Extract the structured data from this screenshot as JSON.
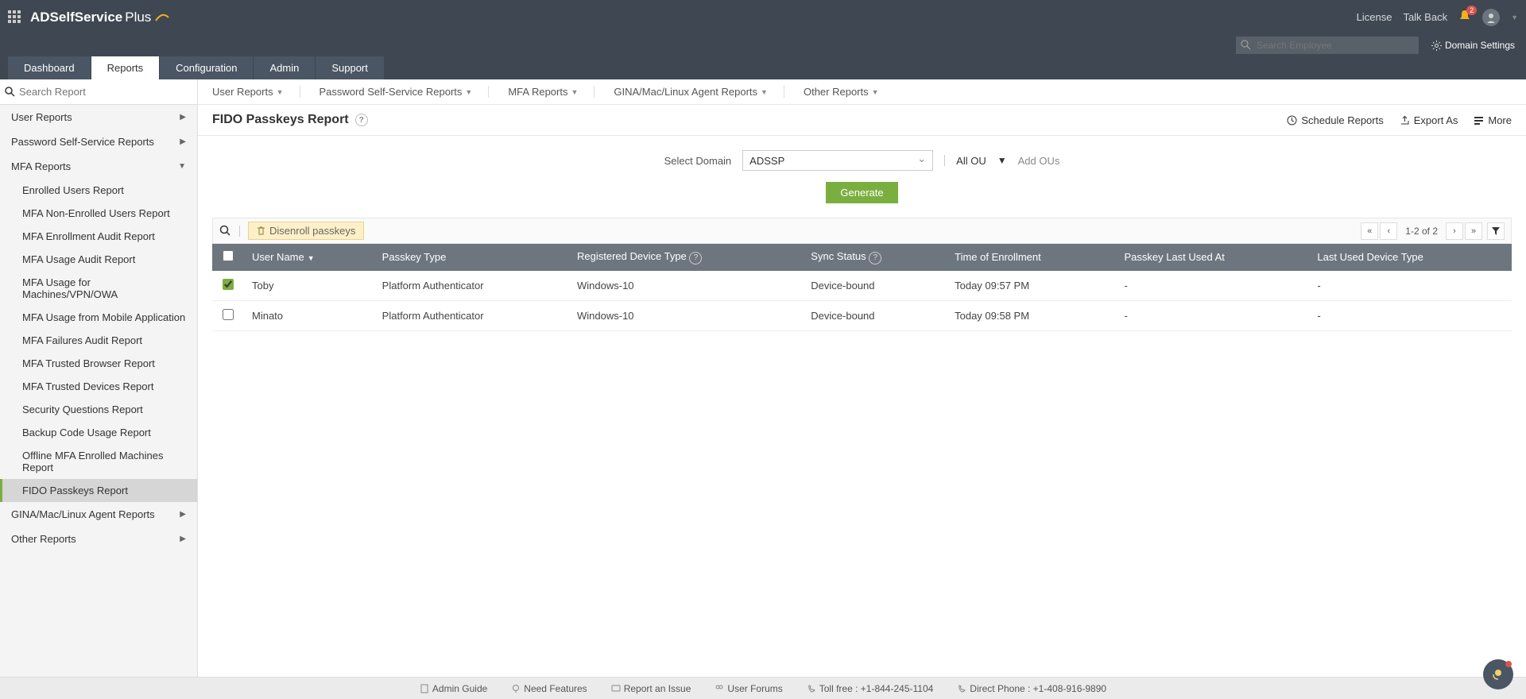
{
  "app_name": "ADSelfService",
  "app_suffix": "Plus",
  "top_links": {
    "license": "License",
    "talk_back": "Talk Back"
  },
  "notif_count": "2",
  "search_employee_ph": "Search Employee",
  "domain_settings": "Domain Settings",
  "tabs": [
    "Dashboard",
    "Reports",
    "Configuration",
    "Admin",
    "Support"
  ],
  "search_report_ph": "Search Report",
  "sidebar": {
    "user_reports": "User Reports",
    "pss_reports": "Password Self-Service Reports",
    "mfa_reports": "MFA Reports",
    "mfa_children": [
      "Enrolled Users Report",
      "MFA Non-Enrolled Users Report",
      "MFA Enrollment Audit Report",
      "MFA Usage Audit Report",
      "MFA Usage for Machines/VPN/OWA",
      "MFA Usage from Mobile Application",
      "MFA Failures Audit Report",
      "MFA Trusted Browser Report",
      "MFA Trusted Devices Report",
      "Security Questions Report",
      "Backup Code Usage Report",
      "Offline MFA Enrolled Machines Report",
      "FIDO Passkeys Report"
    ],
    "gina_reports": "GINA/Mac/Linux Agent Reports",
    "other_reports": "Other Reports"
  },
  "subnav": [
    "User Reports",
    "Password Self-Service Reports",
    "MFA Reports",
    "GINA/Mac/Linux Agent Reports",
    "Other Reports"
  ],
  "page": {
    "title": "FIDO Passkeys Report",
    "schedule": "Schedule Reports",
    "export": "Export As",
    "more": "More",
    "select_domain": "Select Domain",
    "domain_value": "ADSSP",
    "all_ou": "All OU",
    "add_ous": "Add OUs",
    "generate": "Generate",
    "disenroll": "Disenroll passkeys",
    "pagination": "1-2 of 2"
  },
  "columns": [
    "User Name",
    "Passkey Type",
    "Registered Device Type",
    "Sync Status",
    "Time of Enrollment",
    "Passkey Last Used At",
    "Last Used Device Type"
  ],
  "rows": [
    {
      "checked": true,
      "user": "Toby",
      "ptype": "Platform Authenticator",
      "device": "Windows-10",
      "sync": "Device-bound",
      "time": "Today 09:57 PM",
      "last": "-",
      "lastdev": "-"
    },
    {
      "checked": false,
      "user": "Minato",
      "ptype": "Platform Authenticator",
      "device": "Windows-10",
      "sync": "Device-bound",
      "time": "Today 09:58 PM",
      "last": "-",
      "lastdev": "-"
    }
  ],
  "footer": {
    "admin_guide": "Admin Guide",
    "need_features": "Need Features",
    "report_issue": "Report an Issue",
    "user_forums": "User Forums",
    "toll_free": "Toll free : +1-844-245-1104",
    "direct_phone": "Direct Phone : +1-408-916-9890"
  }
}
